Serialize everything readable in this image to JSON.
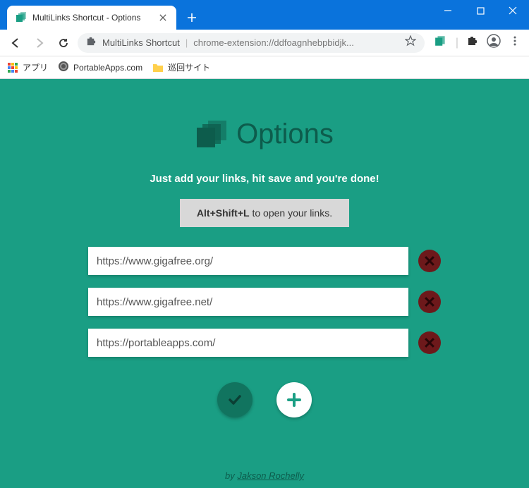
{
  "browser": {
    "tab_title": "MultiLinks Shortcut - Options",
    "omnibox_label": "MultiLinks Shortcut",
    "omnibox_url": "chrome-extension://ddfoagnhebpbidjk...",
    "bookmarks": {
      "apps": "アプリ",
      "portable": "PortableApps.com",
      "folder": "巡回サイト"
    }
  },
  "page": {
    "title": "Options",
    "subtitle": "Just add your links, hit save and you're done!",
    "hint_key": "Alt+Shift+L",
    "hint_rest": " to open your links.",
    "links": [
      "https://www.gigafree.org/",
      "https://www.gigafree.net/",
      "https://portableapps.com/"
    ],
    "credit_prefix": "by ",
    "credit_name": "Jakson Rochelly"
  }
}
